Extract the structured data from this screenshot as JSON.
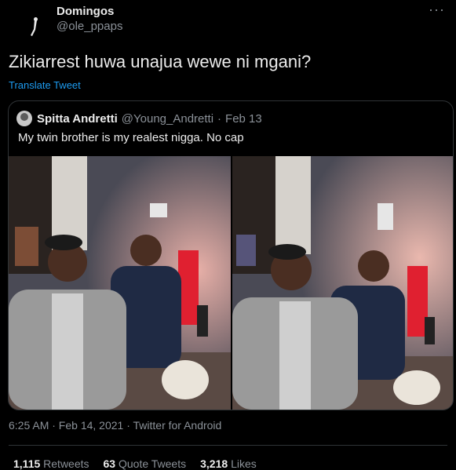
{
  "author": {
    "display_name": "Domingos",
    "handle": "@ole_ppaps"
  },
  "tweet": {
    "text": "Zikiarrest huwa unajua wewe ni mgani?",
    "translate_label": "Translate Tweet"
  },
  "quoted": {
    "display_name": "Spitta Andretti",
    "handle": "@Young_Andretti",
    "separator": "·",
    "date": "Feb 13",
    "text": "My twin brother is my realest nigga. No cap"
  },
  "meta": {
    "timestamp": "6:25 AM · Feb 14, 2021 · Twitter for Android"
  },
  "stats": {
    "retweets_count": "1,115",
    "retweets_label": "Retweets",
    "quotes_count": "63",
    "quotes_label": "Quote Tweets",
    "likes_count": "3,218",
    "likes_label": "Likes"
  },
  "colors": {
    "background": "#000000",
    "link": "#1d9bf0",
    "muted": "#8b9198",
    "border": "#2f3336"
  }
}
